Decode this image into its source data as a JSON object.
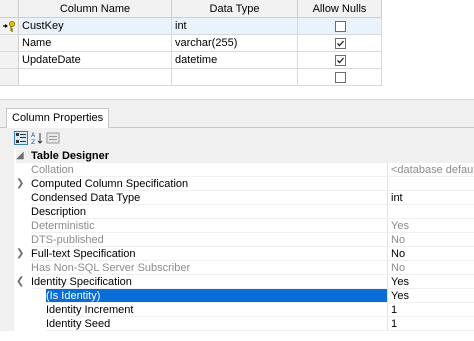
{
  "grid": {
    "headers": [
      "Column Name",
      "Data Type",
      "Allow Nulls"
    ],
    "rows": [
      {
        "name": "CustKey",
        "type": "int",
        "allow_nulls": false,
        "primary_key": true
      },
      {
        "name": "Name",
        "type": "varchar(255)",
        "allow_nulls": true,
        "primary_key": false
      },
      {
        "name": "UpdateDate",
        "type": "datetime",
        "allow_nulls": true,
        "primary_key": false
      },
      {
        "name": "",
        "type": "",
        "allow_nulls": false,
        "primary_key": false
      }
    ]
  },
  "properties": {
    "tab_label": "Column Properties",
    "rows": [
      {
        "name": "Table Designer",
        "value": "",
        "kind": "category",
        "expander": "expanded"
      },
      {
        "name": "Collation",
        "value": "<database default>",
        "disabled": true
      },
      {
        "name": "Computed Column Specification",
        "value": "",
        "expander": "collapsed"
      },
      {
        "name": "Condensed Data Type",
        "value": "int"
      },
      {
        "name": "Description",
        "value": ""
      },
      {
        "name": "Deterministic",
        "value": "Yes",
        "disabled": true
      },
      {
        "name": "DTS-published",
        "value": "No",
        "disabled": true
      },
      {
        "name": "Full-text Specification",
        "value": "No",
        "expander": "collapsed"
      },
      {
        "name": "Has Non-SQL Server Subscriber",
        "value": "No",
        "disabled": true
      },
      {
        "name": "Identity Specification",
        "value": "Yes",
        "expander": "expanded"
      },
      {
        "name": "(Is Identity)",
        "value": "Yes",
        "level": 2,
        "selected": true
      },
      {
        "name": "Identity Increment",
        "value": "1",
        "level": 2
      },
      {
        "name": "Identity Seed",
        "value": "1",
        "level": 2
      }
    ]
  },
  "colors": {
    "selection": "#0a6cd6",
    "header_bg": "#f2f2f2",
    "disabled_text": "#8c8c8c"
  }
}
